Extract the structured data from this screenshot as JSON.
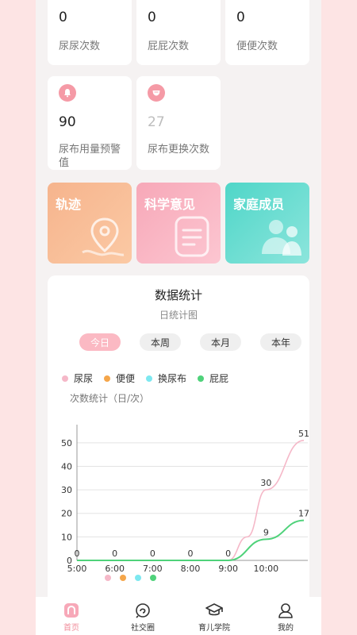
{
  "stats": {
    "pee_count": {
      "value": "0",
      "label": "尿尿次数"
    },
    "fart_count": {
      "value": "0",
      "label": "屁屁次数"
    },
    "poop_count": {
      "value": "0",
      "label": "便便次数"
    },
    "diaper_warning": {
      "value": "90",
      "label": "尿布用量预警值"
    },
    "diaper_changes": {
      "value": "27",
      "label": "尿布更换次数"
    }
  },
  "features": [
    {
      "title": "轨迹",
      "icon": "location-pin-icon"
    },
    {
      "title": "科学意见",
      "icon": "document-icon"
    },
    {
      "title": "家庭成员",
      "icon": "people-icon"
    }
  ],
  "stats_panel": {
    "title": "数据统计",
    "subtitle": "日统计图",
    "tabs": [
      "今日",
      "本周",
      "本月",
      "本年"
    ],
    "active_tab": "今日",
    "legend": [
      {
        "name": "尿尿",
        "color": "#f5b8c8"
      },
      {
        "name": "便便",
        "color": "#f5a64a"
      },
      {
        "name": "换尿布",
        "color": "#7de8f0"
      },
      {
        "name": "屁屁",
        "color": "#4fd27a"
      }
    ],
    "ylabel": "次数统计（日/次）"
  },
  "chart_data": {
    "type": "line",
    "categories": [
      "5:00",
      "6:00",
      "7:00",
      "8:00",
      "9:00",
      "10:00"
    ],
    "x": [
      5,
      6,
      7,
      8,
      9,
      9.5,
      10,
      11
    ],
    "ylim": [
      0,
      55
    ],
    "yticks": [
      0,
      10,
      20,
      30,
      40,
      50
    ],
    "series": [
      {
        "name": "尿尿",
        "color": "#f5b8c8",
        "x": [
          5,
          6,
          7,
          8,
          9,
          9.5,
          10,
          11
        ],
        "values": [
          0,
          0,
          0,
          0,
          0,
          10,
          30,
          51
        ],
        "labels": [
          null,
          null,
          null,
          null,
          null,
          null,
          "30",
          "51"
        ]
      },
      {
        "name": "屁屁",
        "color": "#4fd27a",
        "x": [
          5,
          6,
          7,
          8,
          9,
          10,
          11
        ],
        "values": [
          0,
          0,
          0,
          0,
          0,
          9,
          17
        ],
        "labels": [
          "0",
          "0",
          "0",
          "0",
          "0",
          "9",
          "17"
        ]
      }
    ],
    "grid": true
  },
  "tabbar": [
    {
      "label": "首页",
      "icon": "home-icon",
      "active": true
    },
    {
      "label": "社交圈",
      "icon": "social-icon",
      "active": false
    },
    {
      "label": "育儿学院",
      "icon": "graduation-cap-icon",
      "active": false
    },
    {
      "label": "我的",
      "icon": "user-icon",
      "active": false
    }
  ]
}
